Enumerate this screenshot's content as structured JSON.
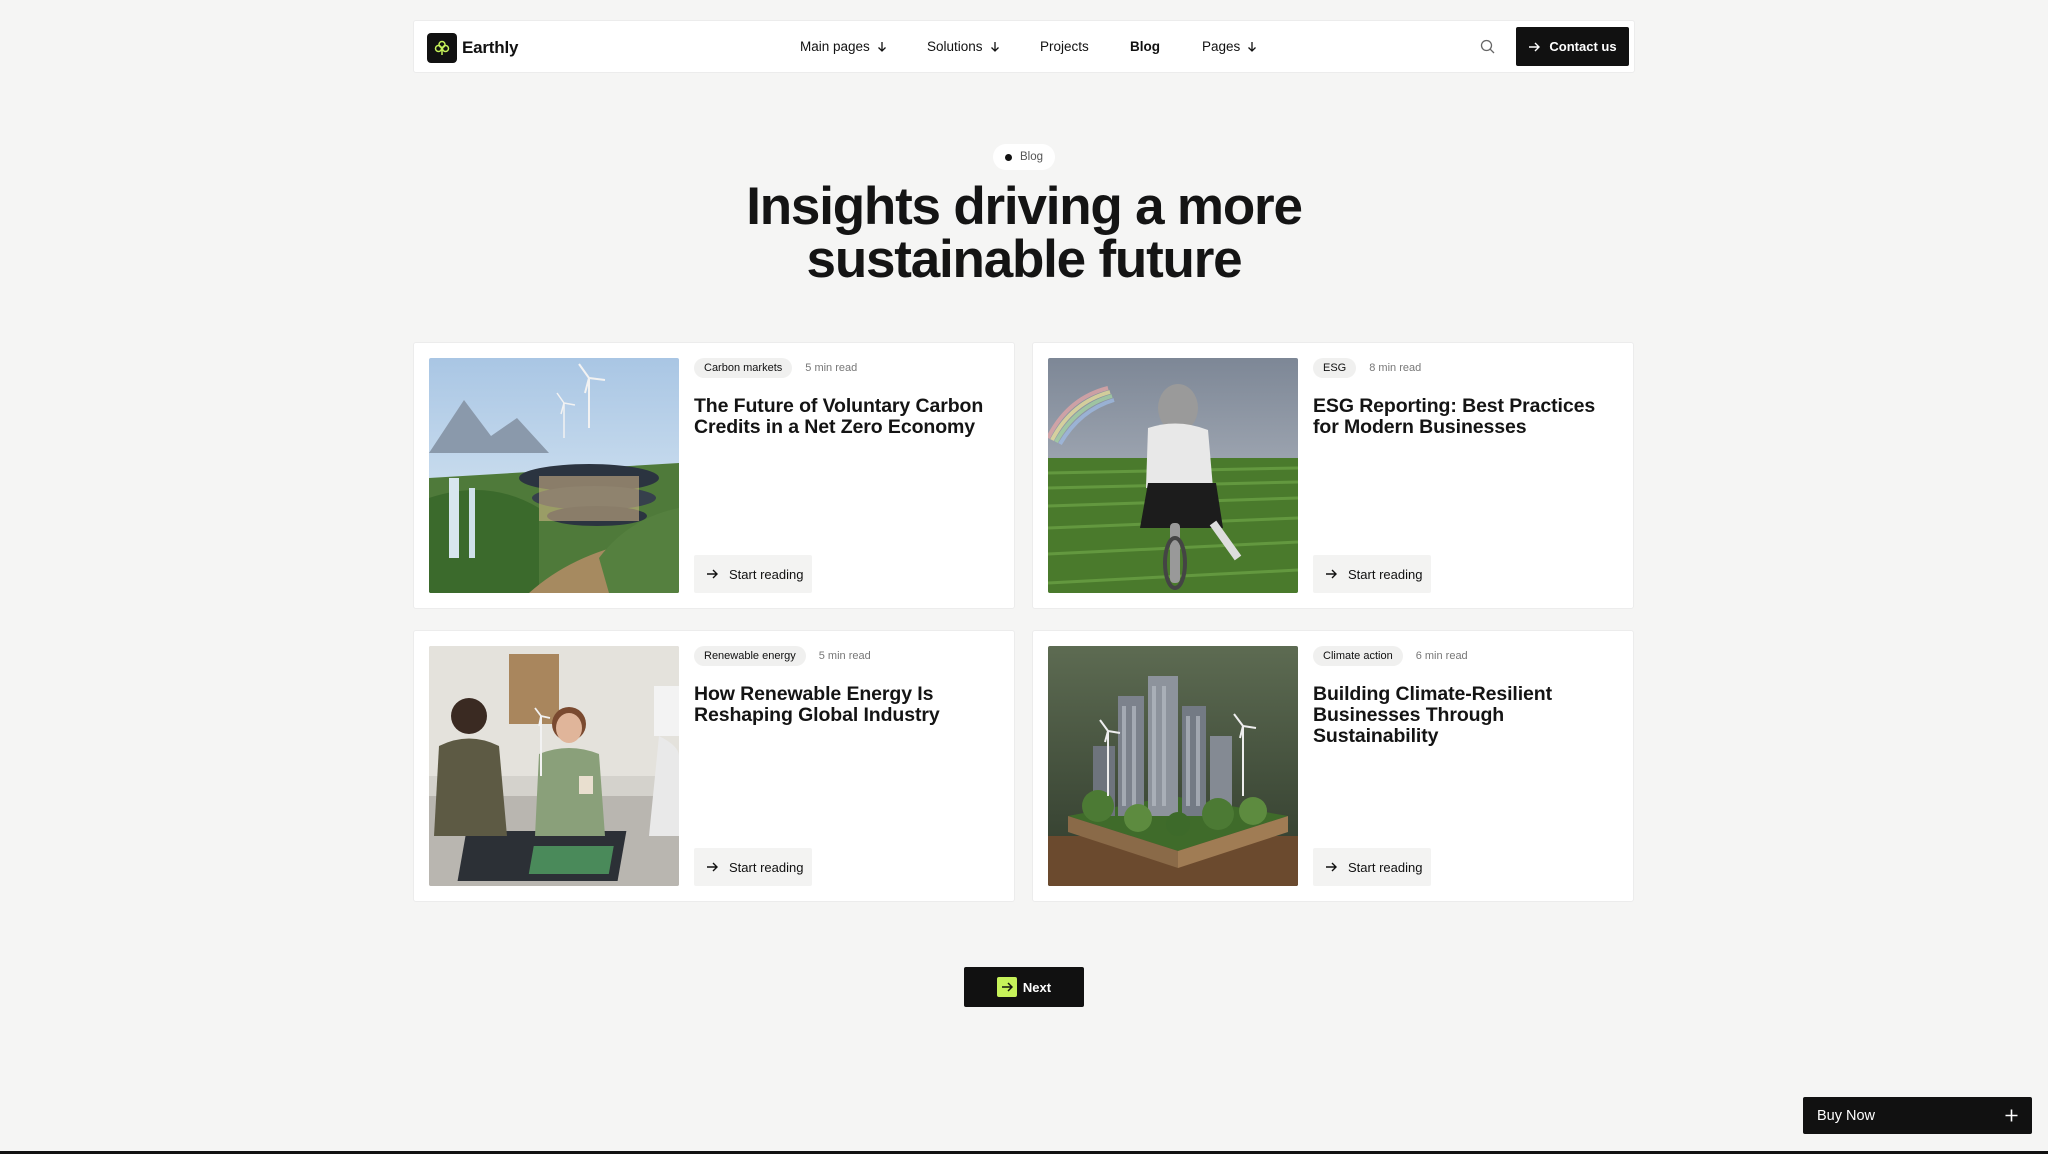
{
  "brand": {
    "name": "Earthly",
    "accent": "#c6f25a"
  },
  "nav": {
    "items": [
      {
        "label": "Main pages",
        "has_dropdown": true
      },
      {
        "label": "Solutions",
        "has_dropdown": true
      },
      {
        "label": "Projects",
        "has_dropdown": false
      },
      {
        "label": "Blog",
        "has_dropdown": false,
        "active": true
      },
      {
        "label": "Pages",
        "has_dropdown": true
      }
    ],
    "search_icon": "search-icon",
    "contact_label": "Contact us"
  },
  "hero": {
    "eyebrow": "Blog",
    "title_line1": "Insights driving a more",
    "title_line2": "sustainable future"
  },
  "posts": [
    {
      "tag": "Carbon markets",
      "read_time": "5 min read",
      "title": "The Future of Voluntary Carbon Credits in a Net Zero Economy",
      "cta": "Start reading"
    },
    {
      "tag": "ESG",
      "read_time": "8 min read",
      "title": "ESG Reporting: Best Practices for Modern Businesses",
      "cta": "Start reading"
    },
    {
      "tag": "Renewable energy",
      "read_time": "5 min read",
      "title": "How Renewable Energy Is Reshaping Global Industry",
      "cta": "Start reading"
    },
    {
      "tag": "Climate action",
      "read_time": "6 min read",
      "title": "Building Climate-Resilient Businesses Through Sustainability",
      "cta": "Start reading"
    }
  ],
  "pagination": {
    "next_label": "Next"
  },
  "buy_now": {
    "label": "Buy Now"
  }
}
